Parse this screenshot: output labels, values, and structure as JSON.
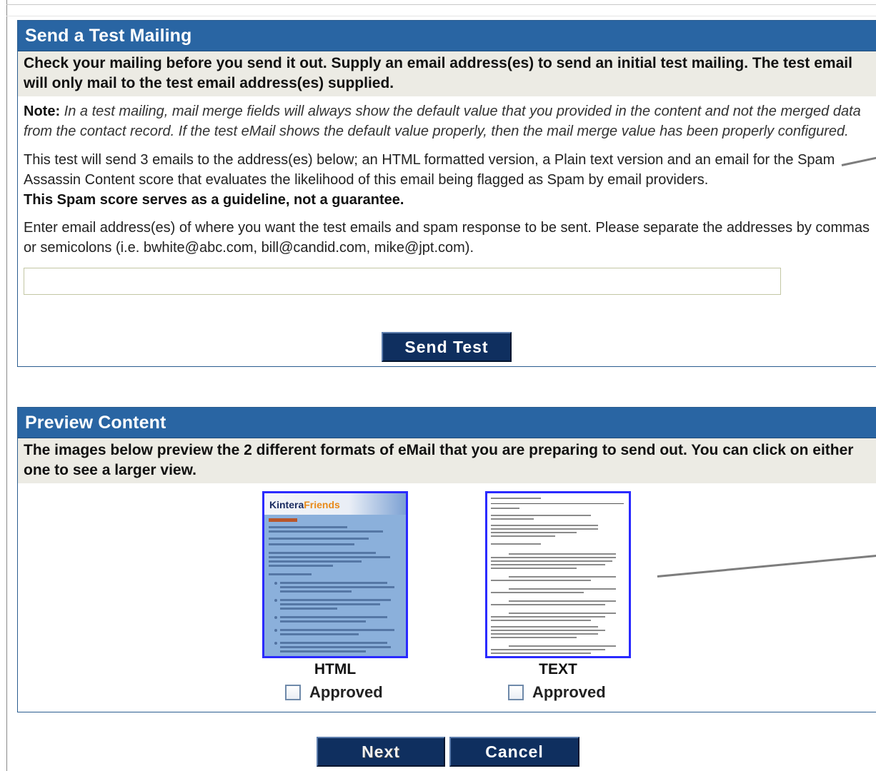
{
  "test_mailing": {
    "title": "Send a Test Mailing",
    "intro": "Check your mailing before you send it out. Supply an email address(es) to send an initial test mailing. The test email will only mail to the test email address(es) supplied.",
    "note_label": "Note:",
    "note_text": "In a test mailing, mail merge fields will always show the default value that you provided in the content and not the merged data from the contact record.  If the test eMail shows the default value properly, then the mail merge value has been properly configured.",
    "info_text": "This test will send 3 emails to the address(es) below; an HTML formatted version, a Plain text version and an email for the Spam Assassin Content score that evaluates the likelihood of this email being flagged as Spam by email providers.",
    "info_bold": "This Spam score serves as a guideline, not a guarantee.",
    "instructions": "Enter email address(es) of where you want the test emails and spam response to be sent. Please separate the addresses by commas or semicolons (i.e. bwhite@abc.com, bill@candid.com, mike@jpt.com).",
    "email_value": "",
    "send_label": "Send Test"
  },
  "preview": {
    "title": "Preview Content",
    "intro": "The images below preview the 2 different formats of eMail that you are preparing to send out. You can click on either one to see a larger view.",
    "html_thumb": {
      "logo_main": "Kintera",
      "logo_accent": "Friends",
      "label": "HTML",
      "approved_label": "Approved",
      "approved": false
    },
    "text_thumb": {
      "label": "TEXT",
      "approved_label": "Approved",
      "approved": false
    }
  },
  "actions": {
    "next_label": "Next",
    "cancel_label": "Cancel"
  }
}
